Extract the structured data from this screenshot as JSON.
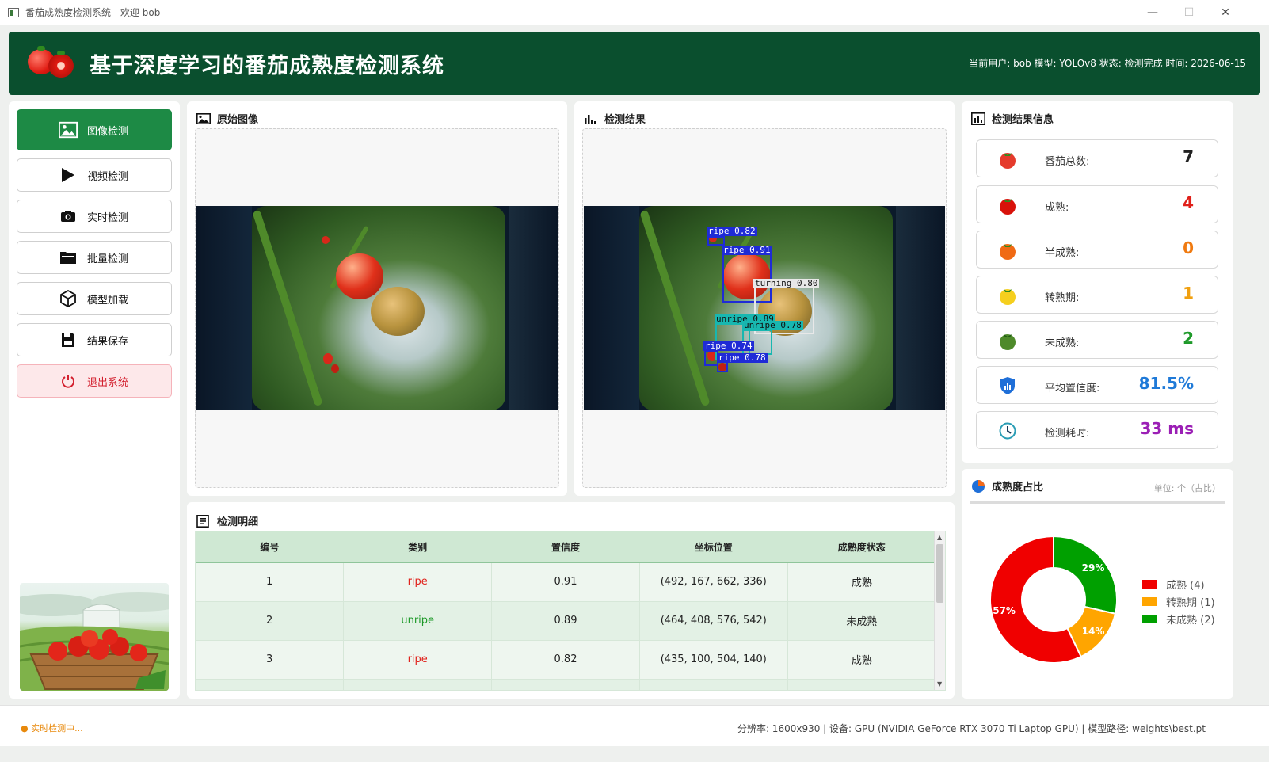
{
  "window": {
    "title": "番茄成熟度检测系统 - 欢迎 bob",
    "controls": [
      "—",
      "☐",
      "✕"
    ]
  },
  "header": {
    "title": "基于深度学习的番茄成熟度检测系统",
    "info": "当前用户: bob  模型: YOLOv8  状态: 检测完成  时间: 2026-06-15"
  },
  "sidebar": {
    "items": [
      {
        "label": "图像检测",
        "icon": "image-icon",
        "active": true
      },
      {
        "label": "视频检测",
        "icon": "play-icon"
      },
      {
        "label": "实时检测",
        "icon": "camera-icon"
      },
      {
        "label": "批量检测",
        "icon": "folder-icon"
      },
      {
        "label": "模型加载",
        "icon": "cube-icon"
      },
      {
        "label": "结果保存",
        "icon": "save-icon"
      },
      {
        "label": "退出系统",
        "icon": "power-icon",
        "exit": true
      }
    ]
  },
  "original": {
    "title": "原始图像"
  },
  "result": {
    "title": "检测结果",
    "detections": [
      {
        "label": "ripe 0.82",
        "color": "#1f2bd6"
      },
      {
        "label": "ripe 0.91",
        "color": "#1f2bd6"
      },
      {
        "label": "turning 0.80",
        "color": "#e8e8e8"
      },
      {
        "label": "unripe 0.89",
        "color": "#18b7b0"
      },
      {
        "label": "unripe 0.78",
        "color": "#18b7b0"
      },
      {
        "label": "ripe 0.74",
        "color": "#1f2bd6"
      },
      {
        "label": "ripe 0.78",
        "color": "#1f2bd6"
      }
    ]
  },
  "info": {
    "title": "检测结果信息",
    "stats": [
      {
        "label": "番茄总数:",
        "value": "7",
        "color": "#222222",
        "icon": "tomato-red-icon"
      },
      {
        "label": "成熟:",
        "value": "4",
        "color": "#e0201a",
        "icon": "tomato-ripe-icon"
      },
      {
        "label": "半成熟:",
        "value": "0",
        "color": "#f07a10",
        "icon": "tomato-half-icon"
      },
      {
        "label": "转熟期:",
        "value": "1",
        "color": "#f0a010",
        "icon": "tomato-turning-icon"
      },
      {
        "label": "未成熟:",
        "value": "2",
        "color": "#1f9a2a",
        "icon": "tomato-unripe-icon"
      },
      {
        "label": "平均置信度:",
        "value": "81.5%",
        "color": "#1f7ad8",
        "icon": "shield-icon"
      },
      {
        "label": "检测耗时:",
        "value": "33 ms",
        "color": "#9b1fb5",
        "icon": "clock-icon"
      }
    ]
  },
  "details": {
    "title": "检测明细",
    "columns": [
      "编号",
      "类别",
      "置信度",
      "坐标位置",
      "成熟度状态"
    ],
    "rows": [
      {
        "id": "1",
        "cls": "ripe",
        "cls_color": "#e0201a",
        "conf": "0.91",
        "box": "(492, 167, 662, 336)",
        "state": "成熟"
      },
      {
        "id": "2",
        "cls": "unripe",
        "cls_color": "#1f9a2a",
        "conf": "0.89",
        "box": "(464, 408, 576, 542)",
        "state": "未成熟"
      },
      {
        "id": "3",
        "cls": "ripe",
        "cls_color": "#e0201a",
        "conf": "0.82",
        "box": "(435, 100, 504, 140)",
        "state": "成熟"
      }
    ]
  },
  "chart_panel": {
    "title": "成熟度占比",
    "unit": "单位: 个（占比）"
  },
  "chart_data": {
    "type": "pie",
    "categories": [
      "成熟",
      "转熟期",
      "未成熟"
    ],
    "values": [
      4,
      1,
      2
    ],
    "slice_labels": [
      "57%",
      "14%",
      "29%"
    ],
    "legend": [
      "成熟 (4)",
      "转熟期 (1)",
      "未成熟 (2)"
    ],
    "colors": [
      "#f00000",
      "#ffa500",
      "#00a000"
    ],
    "legend_position": "right"
  },
  "status": {
    "live": "● 实时检测中...",
    "meta": "分辨率: 1600x930  |  设备: GPU (NVIDIA GeForce RTX 3070 Ti Laptop GPU)  |  模型路径: weights\\best.pt"
  }
}
